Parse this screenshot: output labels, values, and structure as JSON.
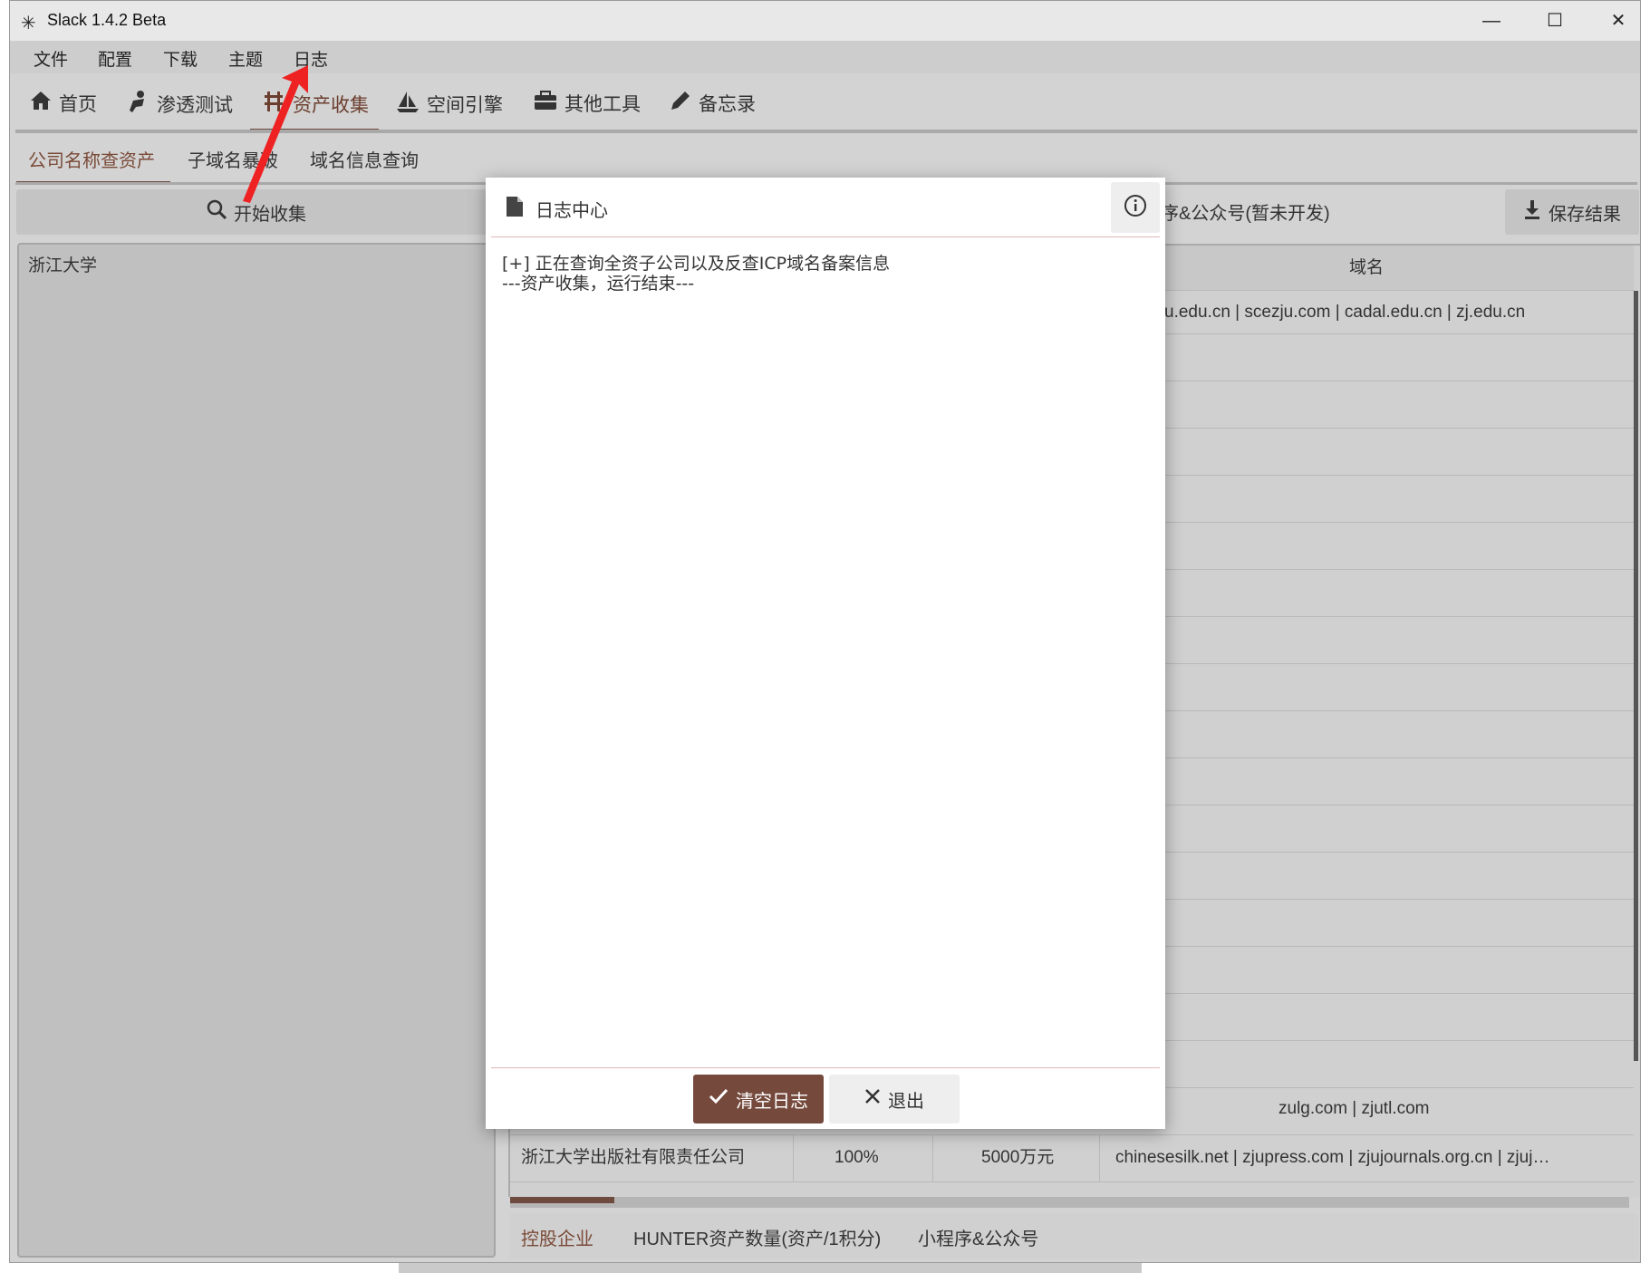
{
  "window": {
    "title": "Slack 1.4.2 Beta",
    "controls": {
      "minimize": "—",
      "maximize": "☐",
      "close": "✕"
    }
  },
  "menu": [
    "文件",
    "配置",
    "下载",
    "主题",
    "日志"
  ],
  "main_tabs": [
    {
      "label": "首页",
      "icon": "home-icon"
    },
    {
      "label": "渗透测试",
      "icon": "user-tool-icon"
    },
    {
      "label": "资产收集",
      "icon": "bridge-icon",
      "active": true
    },
    {
      "label": "空间引擎",
      "icon": "sailboat-icon"
    },
    {
      "label": "其他工具",
      "icon": "toolbox-icon"
    },
    {
      "label": "备忘录",
      "icon": "pencil-icon"
    }
  ],
  "sub_tabs": [
    {
      "label": "公司名称查资产",
      "active": true
    },
    {
      "label": "子域名暴破"
    },
    {
      "label": "域名信息查询"
    }
  ],
  "toolbar": {
    "start_label": "开始收集",
    "hidden_tab_partial": "序&公众号(暂未开发)",
    "save_label": "保存结果"
  },
  "left_input": "浙江大学",
  "table": {
    "header_domain": "域名",
    "row1_domain_partial": "u.edu.cn | scezju.com | cadal.edu.cn | zj.edu.cn",
    "row_zulg_domain": "zulg.com | zjutl.com",
    "row_press": {
      "company": "浙江大学出版社有限责任公司",
      "ratio": "100%",
      "capital": "5000万元",
      "domains": "chinesesilk.net | zjupress.com | zjujournals.org.cn | zjuj…"
    }
  },
  "bottom_tabs": [
    {
      "label": "控股企业",
      "active": true
    },
    {
      "label": "HUNTER资产数量(资产/1积分)"
    },
    {
      "label": "小程序&公众号"
    }
  ],
  "dialog": {
    "title": "日志中心",
    "log_lines": [
      "[+] 正在查询全资子公司以及反查ICP域名备案信息",
      "---资产收集，运行结束---"
    ],
    "clear_label": "清空日志",
    "exit_label": "退出"
  },
  "colors": {
    "accent": "#6e4a3f",
    "window_bg": "#d3d3d3",
    "annotation_arrow": "#ee2222"
  }
}
